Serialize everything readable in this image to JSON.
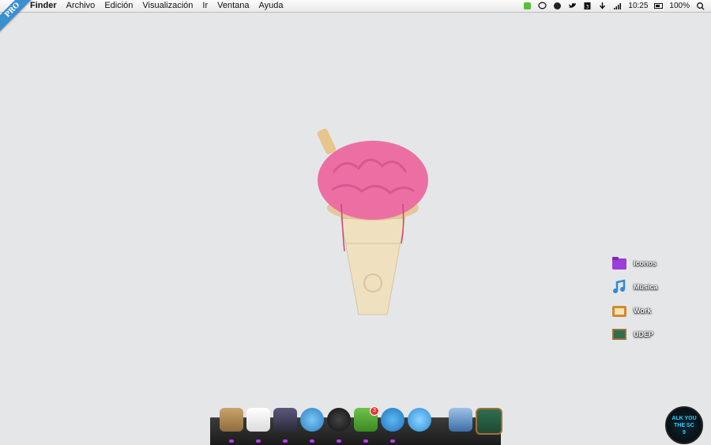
{
  "ribbon": "PRO",
  "menubar": {
    "items": [
      {
        "label": "Finder",
        "bold": true
      },
      {
        "label": "Archivo"
      },
      {
        "label": "Edición"
      },
      {
        "label": "Visualización"
      },
      {
        "label": "Ir"
      },
      {
        "label": "Ventana"
      },
      {
        "label": "Ayuda"
      }
    ],
    "tray": {
      "time": "10:25",
      "battery": "100%"
    }
  },
  "desktop": {
    "items": [
      {
        "label": "Iconos",
        "icon": "folder-icon",
        "color": "#9b3fd6"
      },
      {
        "label": "Música",
        "icon": "music-note-icon",
        "color": "#2f8ad8"
      },
      {
        "label": "Work",
        "icon": "folder-icon",
        "color": "#d08a2e"
      },
      {
        "label": "UDEP",
        "icon": "chalkboard-icon",
        "color": "#2f6d4d"
      }
    ]
  },
  "dock": {
    "badge": "3"
  },
  "widget": {
    "lines": [
      "ALK YOU",
      "THE SC",
      "9"
    ]
  }
}
